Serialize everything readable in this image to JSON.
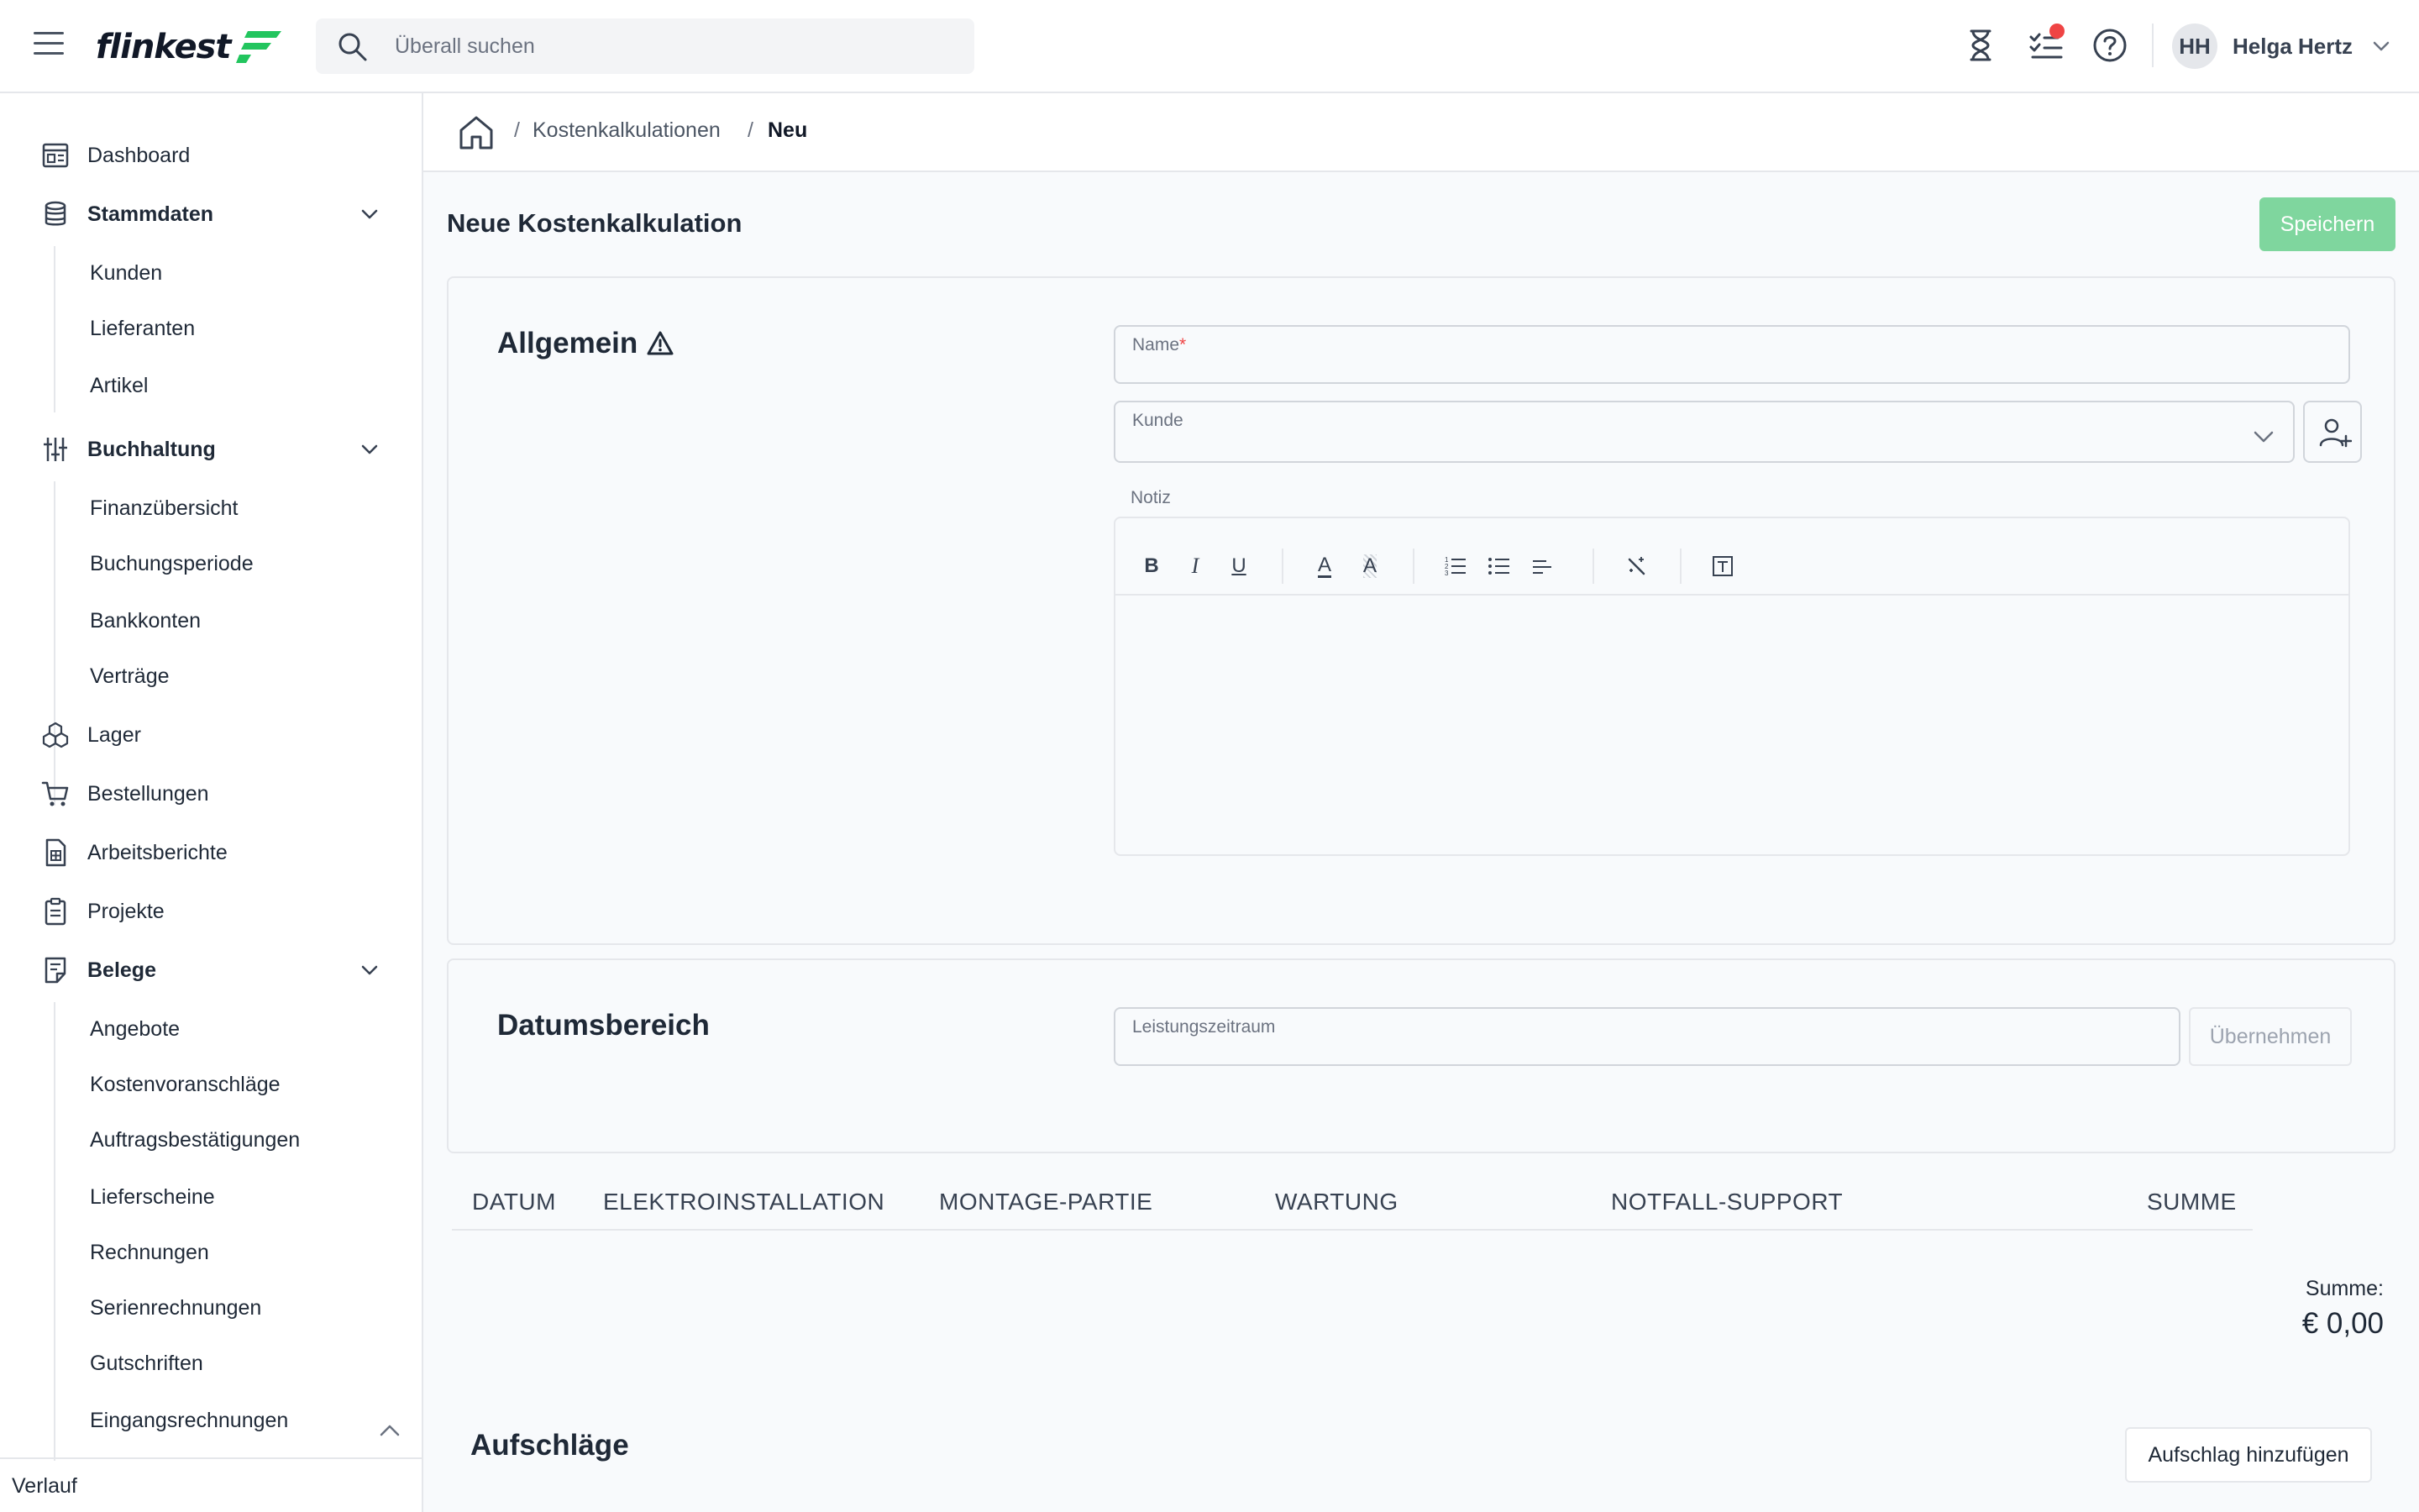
{
  "header": {
    "logo_text": "flinkest",
    "search_placeholder": "Überall suchen",
    "user_initials": "HH",
    "user_name": "Helga Hertz",
    "notification_color": "#ef4444",
    "icons": [
      "menu-icon",
      "search-icon",
      "hourglass-icon",
      "tasks-icon",
      "help-icon",
      "chevron-down-icon"
    ]
  },
  "sidebar": {
    "dashboard": "Dashboard",
    "stammdaten": "Stammdaten",
    "stammdaten_items": [
      "Kunden",
      "Lieferanten",
      "Artikel"
    ],
    "buchhaltung": "Buchhaltung",
    "buchhaltung_items": [
      "Finanzübersicht",
      "Buchungsperiode",
      "Bankkonten",
      "Verträge"
    ],
    "lager": "Lager",
    "bestellungen": "Bestellungen",
    "arbeitsberichte": "Arbeitsberichte",
    "projekte": "Projekte",
    "belege": "Belege",
    "belege_items": [
      "Angebote",
      "Kostenvoranschläge",
      "Auftragsbestätigungen",
      "Lieferscheine",
      "Rechnungen",
      "Serienrechnungen",
      "Gutschriften",
      "Eingangsrechnungen"
    ],
    "verlauf": "Verlauf"
  },
  "breadcrumb": {
    "separator": "/",
    "parent": "Kostenkalkulationen",
    "current": "Neu"
  },
  "page": {
    "title": "Neue Kostenkalkulation",
    "save_label": "Speichern",
    "save_color": "#7fd69e"
  },
  "allgemein": {
    "title": "Allgemein",
    "name_label": "Name",
    "name_required_mark": "*",
    "name_value": "",
    "kunde_label": "Kunde",
    "kunde_value": "",
    "notiz_label": "Notiz",
    "toolbar": {
      "bold": "B",
      "italic": "I",
      "underline": "U",
      "font_color": "A",
      "highlight": "A"
    }
  },
  "datumsbereich": {
    "title": "Datumsbereich",
    "leistungszeitraum_label": "Leistungszeitraum",
    "leistungszeitraum_value": "",
    "apply_label": "Übernehmen"
  },
  "table": {
    "columns": [
      "DATUM",
      "ELEKTROINSTALLATION",
      "MONTAGE-PARTIE",
      "WARTUNG",
      "NOTFALL-SUPPORT",
      "SUMME"
    ],
    "rows": []
  },
  "summary": {
    "label": "Summe:",
    "value": "€ 0,00"
  },
  "aufschlaege": {
    "title": "Aufschläge",
    "add_label": "Aufschlag hinzufügen"
  }
}
